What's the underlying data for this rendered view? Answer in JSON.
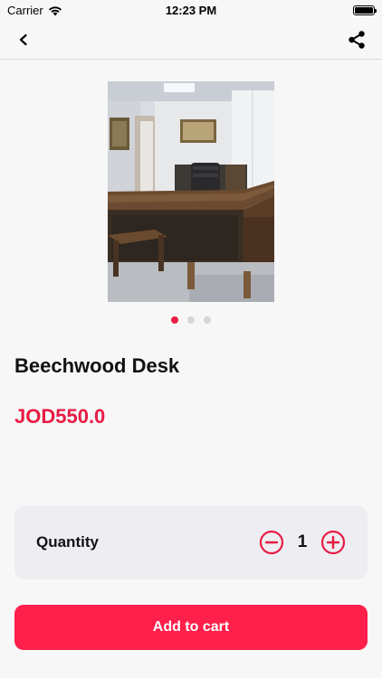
{
  "status_bar": {
    "carrier": "Carrier",
    "time": "12:23 PM"
  },
  "nav": {
    "back_icon": "chevron-left-icon",
    "share_icon": "share-icon"
  },
  "product": {
    "title": "Beechwood Desk",
    "price": "JOD550.0",
    "image_pages": 3,
    "active_page": 1
  },
  "quantity": {
    "label": "Quantity",
    "value": "1"
  },
  "actions": {
    "add_to_cart": "Add to cart"
  },
  "colors": {
    "accent": "#e81c45",
    "button": "#ff1f4b",
    "card": "#eeedf1"
  }
}
